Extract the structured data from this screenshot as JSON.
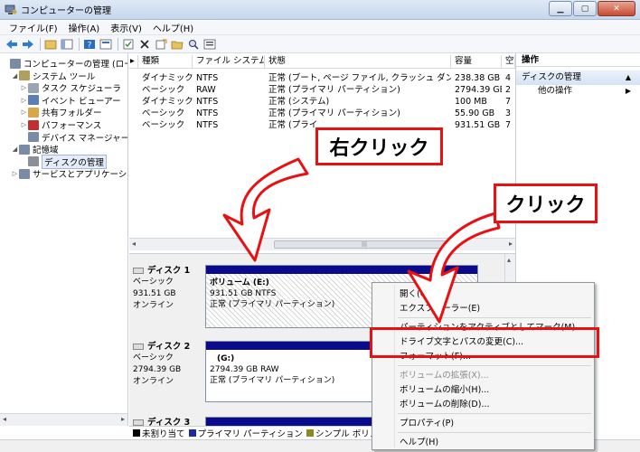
{
  "window": {
    "title": "コンピューターの管理"
  },
  "menu": [
    "ファイル(F)",
    "操作(A)",
    "表示(V)",
    "ヘルプ(H)"
  ],
  "tree": {
    "items": [
      {
        "label": "コンピューターの管理 (ローカ",
        "level": 0,
        "expander": "",
        "icon": "computer-management-icon",
        "color": "#7a8ca5"
      },
      {
        "label": "システム ツール",
        "level": 1,
        "expander": "◢",
        "icon": "system-tools-icon",
        "color": "#b0a060"
      },
      {
        "label": "タスク スケジューラ",
        "level": 2,
        "expander": "▷",
        "icon": "task-scheduler-icon",
        "color": "#9aa4b3"
      },
      {
        "label": "イベント ビューアー",
        "level": 2,
        "expander": "▷",
        "icon": "event-viewer-icon",
        "color": "#5b7fb5"
      },
      {
        "label": "共有フォルダー",
        "level": 2,
        "expander": "▷",
        "icon": "shared-folders-icon",
        "color": "#d8a848"
      },
      {
        "label": "パフォーマンス",
        "level": 2,
        "expander": "▷",
        "icon": "performance-icon",
        "color": "#c03030"
      },
      {
        "label": "デバイス マネージャー",
        "level": 2,
        "expander": "",
        "icon": "device-manager-icon",
        "color": "#7a8ca5"
      },
      {
        "label": "記憶域",
        "level": 1,
        "expander": "◢",
        "icon": "storage-icon",
        "color": "#7a8ca5"
      },
      {
        "label": "ディスクの管理",
        "level": 2,
        "expander": "",
        "icon": "disk-management-icon",
        "color": "#8a8f98",
        "selected": true
      },
      {
        "label": "サービスとアプリケーショ",
        "level": 1,
        "expander": "▷",
        "icon": "services-icon",
        "color": "#7a8ca5"
      }
    ]
  },
  "columns": [
    "種類",
    "ファイル システム",
    "状態",
    "容量",
    "空"
  ],
  "volumes": [
    {
      "type": "ダイナミック",
      "fs": "NTFS",
      "status": "正常 (ブート, ページ ファイル, クラッシュ ダンプ)",
      "capacity": "238.38 GB",
      "free": "4"
    },
    {
      "type": "ベーシック",
      "fs": "RAW",
      "status": "正常 (プライマリ パーティション)",
      "capacity": "2794.39 GB",
      "free": "2"
    },
    {
      "type": "ダイナミック",
      "fs": "NTFS",
      "status": "正常 (システム)",
      "capacity": "100 MB",
      "free": "7"
    },
    {
      "type": "ベーシック",
      "fs": "NTFS",
      "status": "正常 (プライマリ パーティション)",
      "capacity": "55.90 GB",
      "free": "3"
    },
    {
      "type": "ベーシック",
      "fs": "NTFS",
      "status": "正常 (プライ",
      "capacity": "931.51 GB",
      "free": "7"
    }
  ],
  "scroll_thumb": "|||",
  "disks": [
    {
      "name": "ディスク 1",
      "kind": "ベーシック",
      "size": "931.51 GB",
      "state": "オンライン",
      "volume": {
        "title": "ボリューム  (E:)",
        "detail": "931.51 GB NTFS",
        "status": "正常 (プライマリ パーティション)"
      }
    },
    {
      "name": "ディスク 2",
      "kind": "ベーシック",
      "size": "2794.39 GB",
      "state": "オンライン",
      "volume": {
        "title": "(G:)",
        "detail": "2794.39 GB RAW",
        "status": "正常 (プライマリ パーティション)"
      }
    },
    {
      "name": "ディスク 3"
    }
  ],
  "legend": [
    {
      "label": "未割り当て",
      "color": "#000000"
    },
    {
      "label": "プライマリ パーティション",
      "color": "#1a2aa8"
    },
    {
      "label": "シンプル ボリューム",
      "color": "#8a8a20"
    }
  ],
  "actions": {
    "header": "操作",
    "section": "ディスクの管理",
    "item": "他の操作"
  },
  "context_menu": {
    "items": [
      {
        "label": "開く(O)",
        "disabled": false
      },
      {
        "label": "エクスプローラー(E)",
        "disabled": false
      },
      {
        "sep": true
      },
      {
        "label": "パーティションをアクティブとしてマーク(M)",
        "disabled": false
      },
      {
        "label": "ドライブ文字とパスの変更(C)...",
        "disabled": false
      },
      {
        "label": "フォーマット(F)...",
        "disabled": false
      },
      {
        "sep": true
      },
      {
        "label": "ボリュームの拡張(X)...",
        "disabled": true
      },
      {
        "label": "ボリュームの縮小(H)...",
        "disabled": false
      },
      {
        "label": "ボリュームの削除(D)...",
        "disabled": false
      },
      {
        "sep": true
      },
      {
        "label": "プロパティ(P)",
        "disabled": false
      },
      {
        "sep": true
      },
      {
        "label": "ヘルプ(H)",
        "disabled": false
      }
    ]
  },
  "annotations": {
    "right_click": "右クリック",
    "click": "クリック",
    "color": "#e81010"
  }
}
